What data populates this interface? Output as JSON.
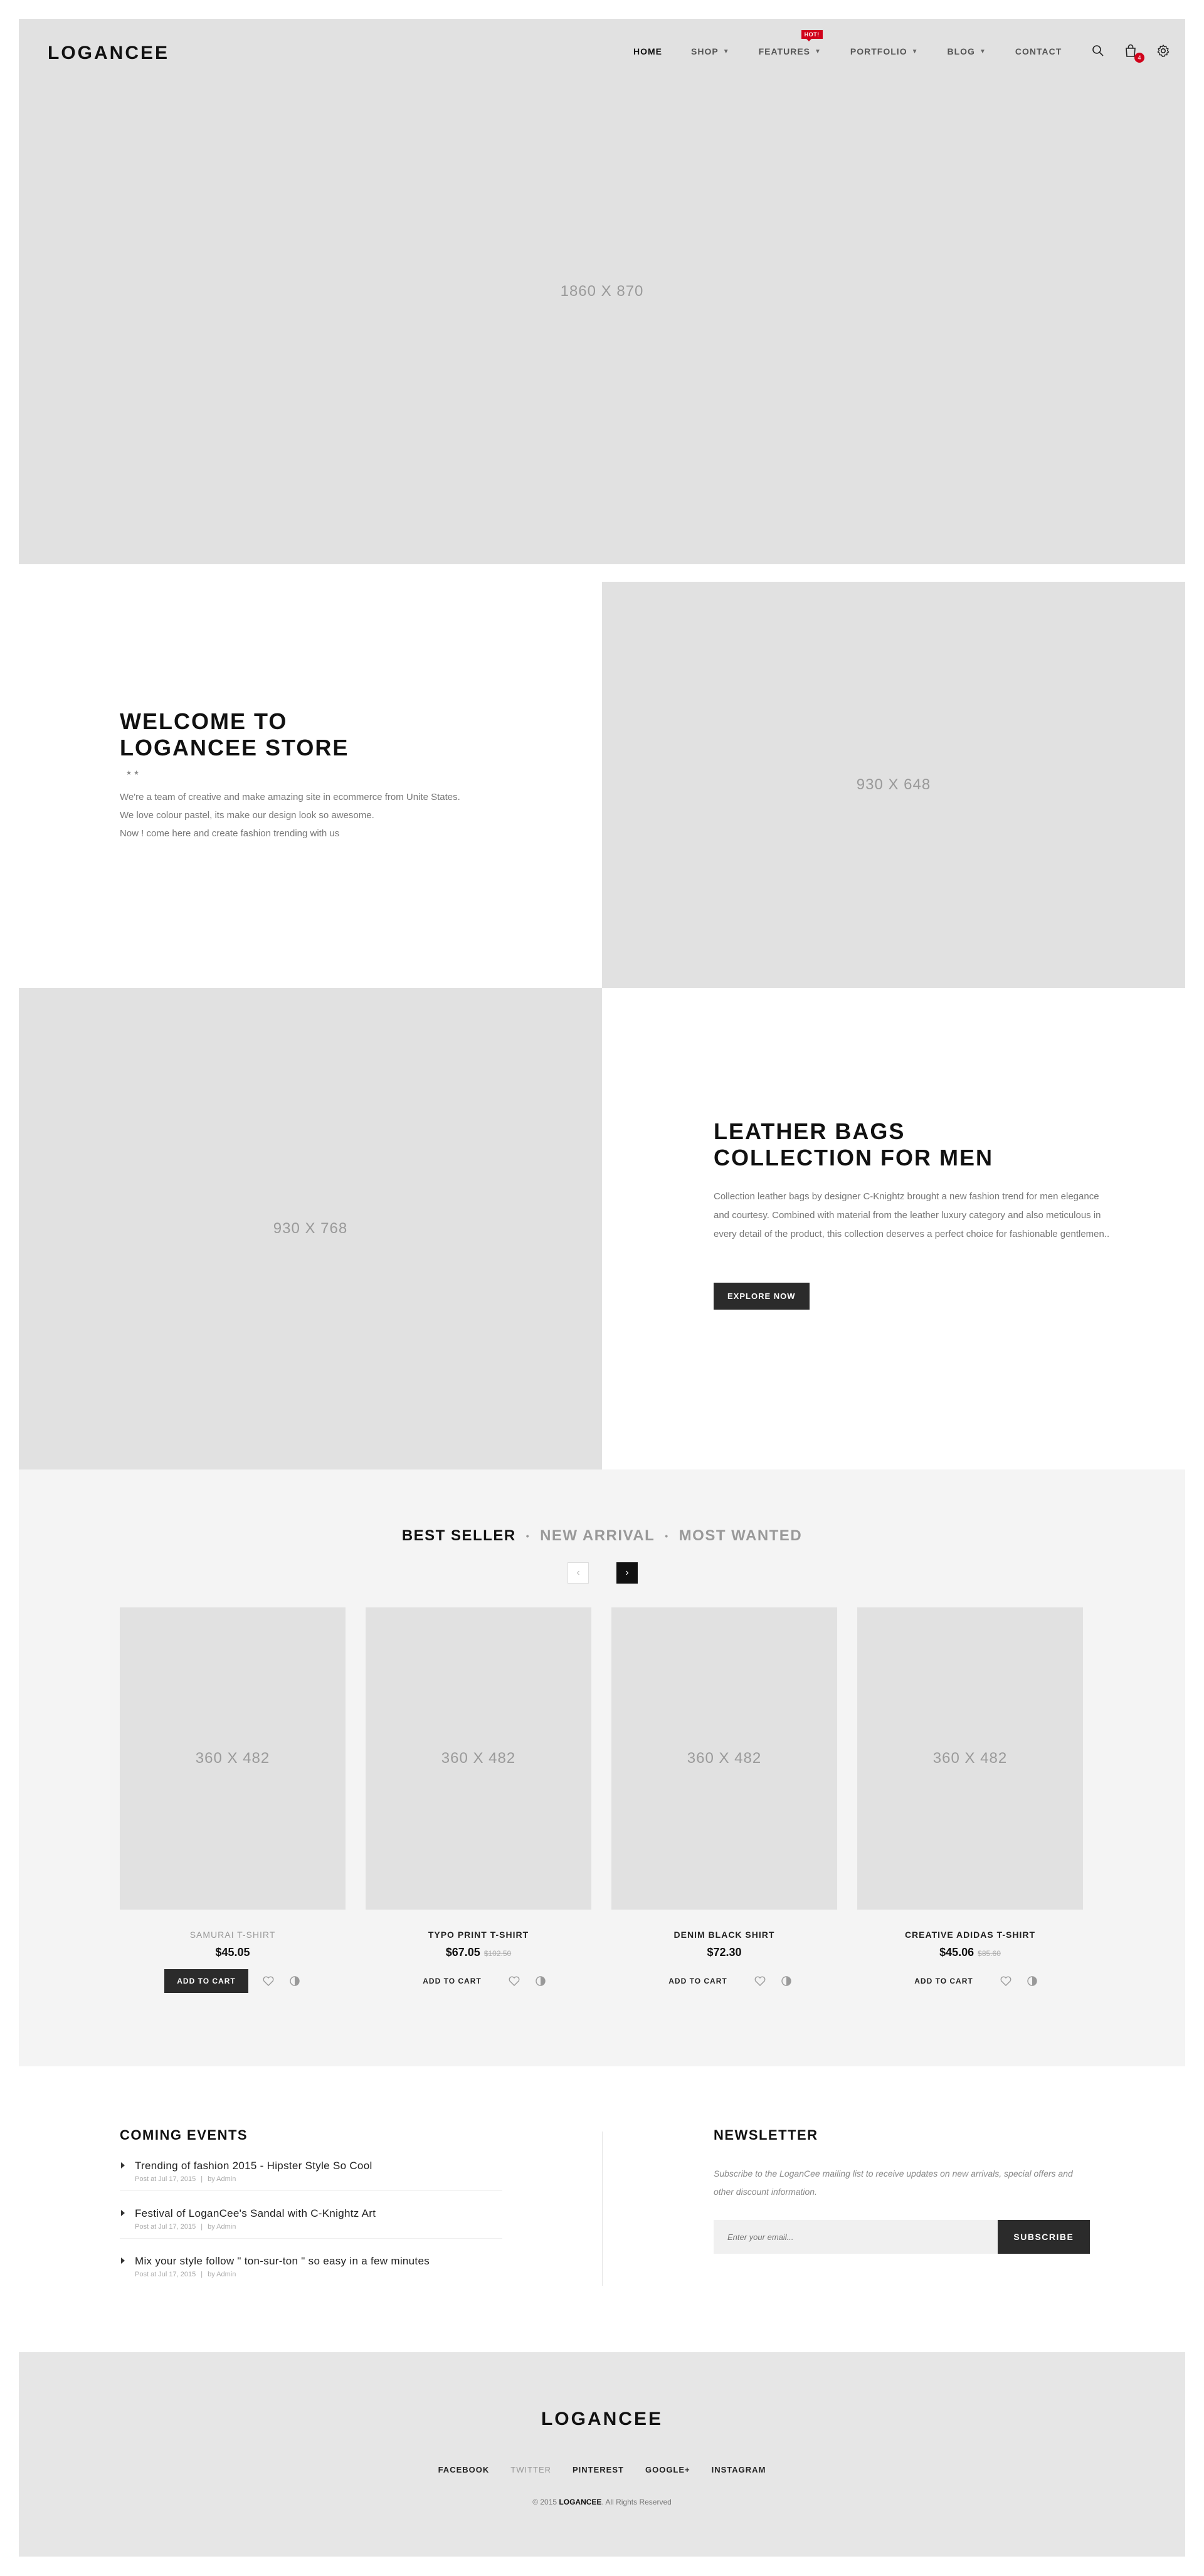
{
  "header": {
    "logo": "LOGANCEE",
    "nav": [
      {
        "label": "HOME",
        "active": true,
        "dropdown": false
      },
      {
        "label": "SHOP",
        "dropdown": true
      },
      {
        "label": "FEATURES",
        "dropdown": true,
        "badge": "HOT!"
      },
      {
        "label": "PORTFOLIO",
        "dropdown": true
      },
      {
        "label": "BLOG",
        "dropdown": true
      },
      {
        "label": "CONTACT",
        "dropdown": false
      }
    ],
    "icons": [
      "search-icon",
      "cart-icon",
      "gear-icon"
    ],
    "cart_count": "4"
  },
  "hero": {
    "placeholder": "1860 X 870"
  },
  "welcome": {
    "title_line1": "WELCOME TO",
    "title_line2": "LOGANCEE STORE",
    "stars": "★★",
    "lines": [
      "We're a team of creative and make amazing site in ecommerce from Unite States.",
      "We love colour pastel, its make our design look so awesome.",
      "Now ! come here and create fashion trending with us"
    ],
    "image_placeholder": "930 X 648"
  },
  "leather": {
    "image_placeholder": "930 X 768",
    "title_line1": "LEATHER BAGS",
    "title_line2": "COLLECTION FOR MEN",
    "description": "Collection leather bags by designer C-Knightz brought a new fashion trend for men elegance and courtesy. Combined with material from the leather luxury category and also meticulous in every detail of the product, this collection deserves a perfect choice for fashionable gentlemen..",
    "button": "EXPLORE NOW"
  },
  "products": {
    "tabs": [
      "BEST SELLER",
      "NEW ARRIVAL",
      "MOST WANTED"
    ],
    "separator": "•",
    "items": [
      {
        "name": "SAMURAI T-SHIRT",
        "price": "$45.05",
        "old_price": "",
        "placeholder": "360 X 482",
        "cart": "ADD TO CART"
      },
      {
        "name": "TYPO PRINT T-SHIRT",
        "price": "$67.05",
        "old_price": "$102.50",
        "placeholder": "360 X 482",
        "cart": "ADD TO CART"
      },
      {
        "name": "DENIM BLACK SHIRT",
        "price": "$72.30",
        "old_price": "",
        "placeholder": "360 X 482",
        "cart": "ADD TO CART"
      },
      {
        "name": "CREATIVE ADIDAS T-SHIRT",
        "price": "$45.06",
        "old_price": "$85.60",
        "placeholder": "360 X 482",
        "cart": "ADD TO CART"
      }
    ]
  },
  "events": {
    "title": "COMING EVENTS",
    "items": [
      {
        "title": "Trending of fashion 2015 - Hipster Style So Cool",
        "date": "Post at Jul 17, 2015",
        "author": "by Admin"
      },
      {
        "title": "Festival of LoganCee's Sandal with C-Knightz Art",
        "date": "Post at Jul 17, 2015",
        "author": "by Admin"
      },
      {
        "title": "Mix your style follow \" ton-sur-ton \" so easy in a few minutes",
        "date": "Post at Jul 17, 2015",
        "author": "by Admin"
      }
    ]
  },
  "newsletter": {
    "title": "NEWSLETTER",
    "text": "Subscribe to the LoganCee mailing list to receive updates on new arrivals, special offers and other discount information.",
    "placeholder": "Enter your email...",
    "button": "SUBSCRIBE"
  },
  "footer": {
    "logo": "LOGANCEE",
    "social": [
      "FACEBOOK",
      "TWITTER",
      "PINTEREST",
      "GOOGLE+",
      "INSTAGRAM"
    ],
    "copy_prefix": "© 2015",
    "copy_brand": "LOGANCEE",
    "copy_suffix": ". All Rights Reserved"
  }
}
